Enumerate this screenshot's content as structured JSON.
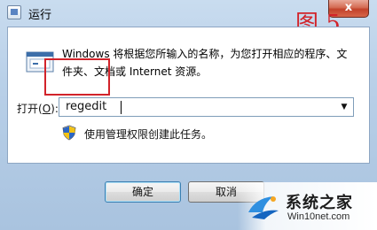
{
  "window": {
    "title": "运行",
    "close_label": "x"
  },
  "annotation": {
    "stamp": "图 5"
  },
  "content": {
    "description": "Windows 将根据您所输入的名称，为您打开相应的程序、文件夹、文档或 Internet 资源。",
    "open_label": "打开(",
    "open_accel": "O",
    "open_label_end": "):",
    "command_value": "regedit",
    "admin_note": "使用管理权限创建此任务。"
  },
  "buttons": {
    "ok": "确定",
    "cancel": "取消"
  },
  "watermark": {
    "title": "系统之家",
    "url": "Win10net.com"
  },
  "icons": {
    "run": "run-program-icon",
    "shield": "uac-shield-icon",
    "dropdown": "chevron-down-icon"
  },
  "colors": {
    "highlight": "#d2232a",
    "titlebar": "#b9d0e8",
    "close_button": "#c2412a"
  }
}
